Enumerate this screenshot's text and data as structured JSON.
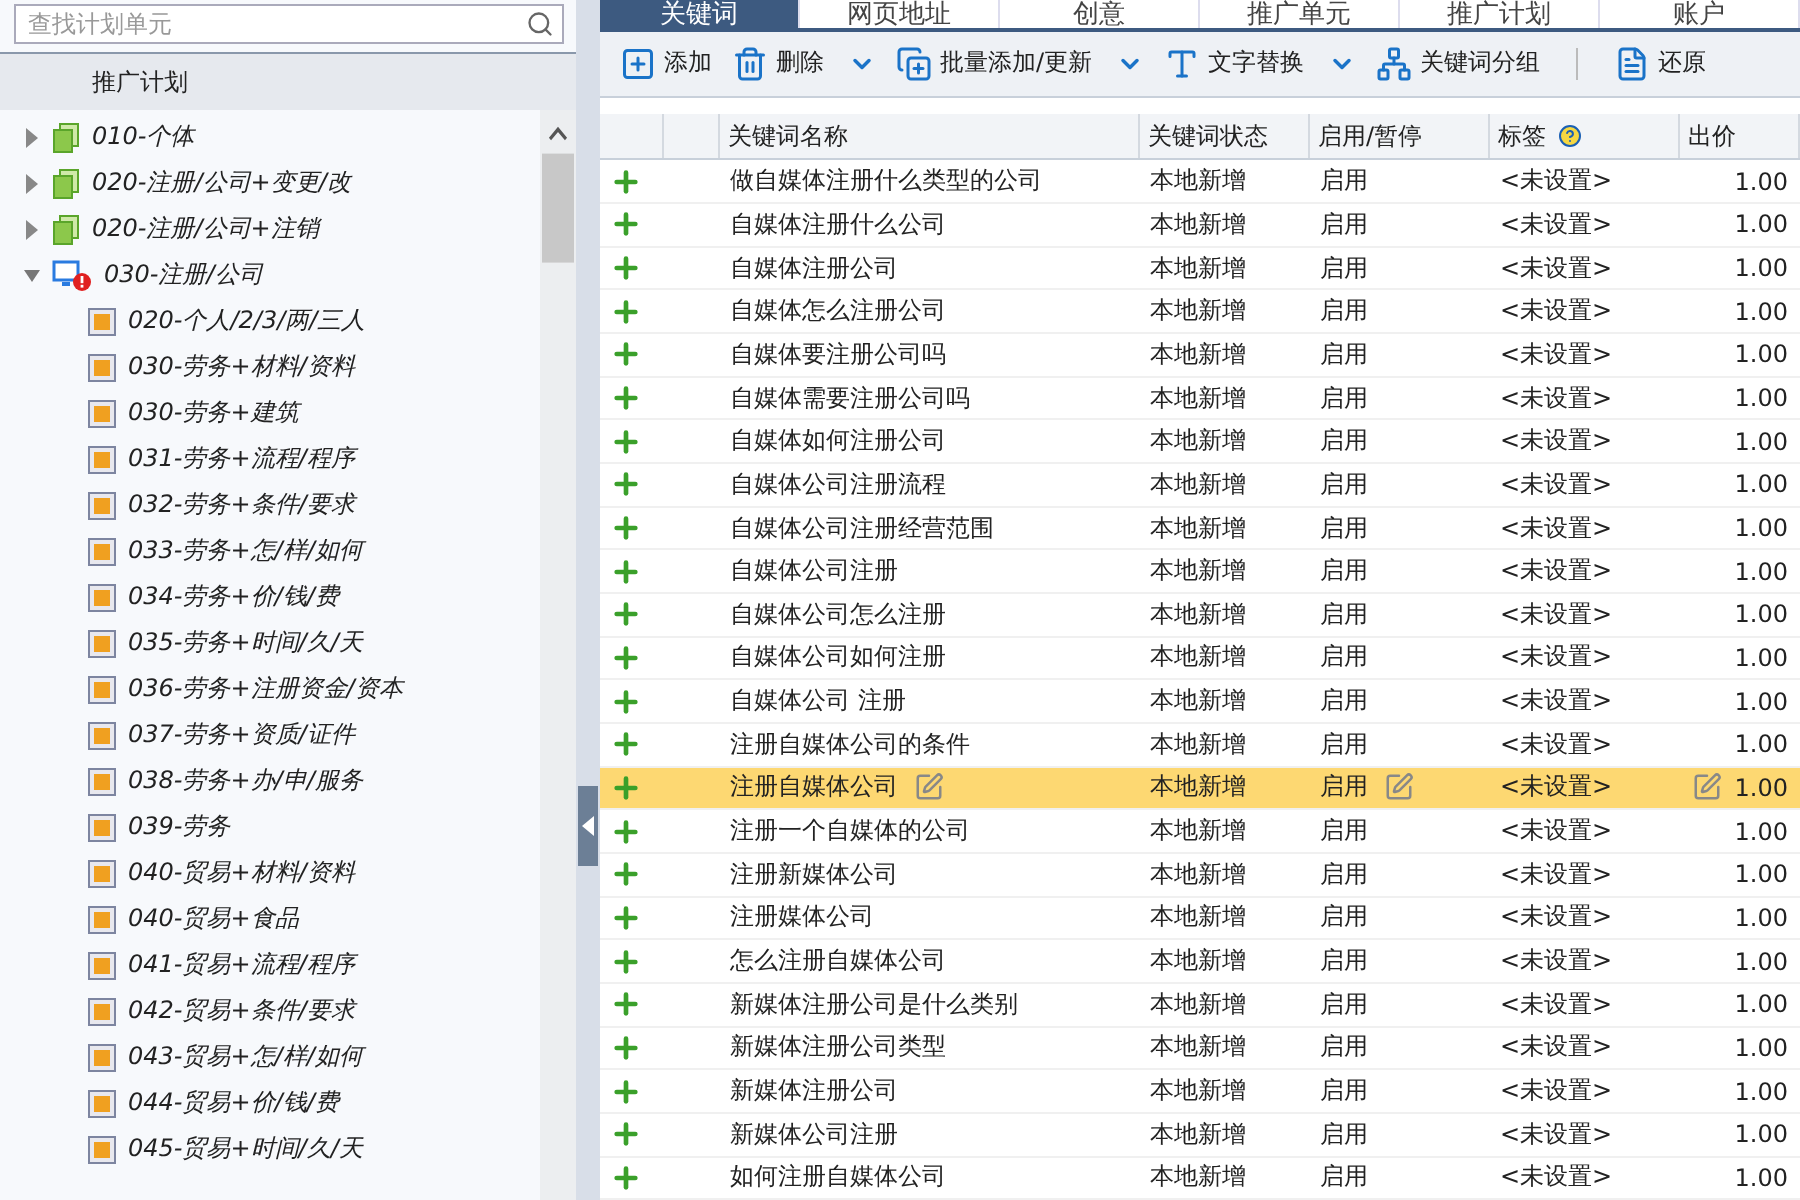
{
  "search": {
    "placeholder": "查找计划单元"
  },
  "sidebar": {
    "header": "推广计划",
    "tree": [
      {
        "label": "010-个体",
        "kind": "plan",
        "expanded": false
      },
      {
        "label": "020-注册/公司+变更/改",
        "kind": "plan",
        "expanded": false
      },
      {
        "label": "020-注册/公司+注销",
        "kind": "plan",
        "expanded": false
      },
      {
        "label": "030-注册/公司",
        "kind": "plan-alert",
        "expanded": true,
        "children": [
          {
            "label": "020-个人/2/3/两/三人",
            "kind": "unit"
          },
          {
            "label": "030-劳务+材料/资料",
            "kind": "unit"
          },
          {
            "label": "030-劳务+建筑",
            "kind": "unit"
          },
          {
            "label": "031-劳务+流程/程序",
            "kind": "unit"
          },
          {
            "label": "032-劳务+条件/要求",
            "kind": "unit"
          },
          {
            "label": "033-劳务+怎/样/如何",
            "kind": "unit"
          },
          {
            "label": "034-劳务+价/钱/费",
            "kind": "unit"
          },
          {
            "label": "035-劳务+时间/久/天",
            "kind": "unit"
          },
          {
            "label": "036-劳务+注册资金/资本",
            "kind": "unit"
          },
          {
            "label": "037-劳务+资质/证件",
            "kind": "unit"
          },
          {
            "label": "038-劳务+办/申/服务",
            "kind": "unit"
          },
          {
            "label": "039-劳务",
            "kind": "unit"
          },
          {
            "label": "040-贸易+材料/资料",
            "kind": "unit"
          },
          {
            "label": "040-贸易+食品",
            "kind": "unit"
          },
          {
            "label": "041-贸易+流程/程序",
            "kind": "unit"
          },
          {
            "label": "042-贸易+条件/要求",
            "kind": "unit"
          },
          {
            "label": "043-贸易+怎/样/如何",
            "kind": "unit"
          },
          {
            "label": "044-贸易+价/钱/费",
            "kind": "unit"
          },
          {
            "label": "045-贸易+时间/久/天",
            "kind": "unit"
          }
        ]
      }
    ]
  },
  "tabs": [
    {
      "label": "关键词",
      "selected": true
    },
    {
      "label": "网页地址",
      "selected": false
    },
    {
      "label": "创意",
      "selected": false
    },
    {
      "label": "推广单元",
      "selected": false
    },
    {
      "label": "推广计划",
      "selected": false
    },
    {
      "label": "账户",
      "selected": false
    }
  ],
  "toolbar": [
    {
      "label": "添加",
      "kind": "add",
      "dropdown": false
    },
    {
      "label": "删除",
      "kind": "delete",
      "dropdown": true
    },
    {
      "label": "批量添加/更新",
      "kind": "batch",
      "dropdown": true
    },
    {
      "label": "文字替换",
      "kind": "replace",
      "dropdown": true
    },
    {
      "label": "关键词分组",
      "kind": "group",
      "dropdown": false
    },
    {
      "label": "还原",
      "kind": "restore",
      "dropdown": false
    }
  ],
  "table": {
    "columns": [
      "关键词名称",
      "关键词状态",
      "启用/暂停",
      "标签",
      "出价"
    ],
    "rows": [
      {
        "name": "做自媒体注册什么类型的公司",
        "status": "本地新增",
        "enabled": "启用",
        "tag": "<未设置>",
        "bid": "1.00",
        "selected": false
      },
      {
        "name": "自媒体注册什么公司",
        "status": "本地新增",
        "enabled": "启用",
        "tag": "<未设置>",
        "bid": "1.00",
        "selected": false
      },
      {
        "name": "自媒体注册公司",
        "status": "本地新增",
        "enabled": "启用",
        "tag": "<未设置>",
        "bid": "1.00",
        "selected": false
      },
      {
        "name": "自媒体怎么注册公司",
        "status": "本地新增",
        "enabled": "启用",
        "tag": "<未设置>",
        "bid": "1.00",
        "selected": false
      },
      {
        "name": "自媒体要注册公司吗",
        "status": "本地新增",
        "enabled": "启用",
        "tag": "<未设置>",
        "bid": "1.00",
        "selected": false
      },
      {
        "name": "自媒体需要注册公司吗",
        "status": "本地新增",
        "enabled": "启用",
        "tag": "<未设置>",
        "bid": "1.00",
        "selected": false
      },
      {
        "name": "自媒体如何注册公司",
        "status": "本地新增",
        "enabled": "启用",
        "tag": "<未设置>",
        "bid": "1.00",
        "selected": false
      },
      {
        "name": "自媒体公司注册流程",
        "status": "本地新增",
        "enabled": "启用",
        "tag": "<未设置>",
        "bid": "1.00",
        "selected": false
      },
      {
        "name": "自媒体公司注册经营范围",
        "status": "本地新增",
        "enabled": "启用",
        "tag": "<未设置>",
        "bid": "1.00",
        "selected": false
      },
      {
        "name": "自媒体公司注册",
        "status": "本地新增",
        "enabled": "启用",
        "tag": "<未设置>",
        "bid": "1.00",
        "selected": false
      },
      {
        "name": "自媒体公司怎么注册",
        "status": "本地新增",
        "enabled": "启用",
        "tag": "<未设置>",
        "bid": "1.00",
        "selected": false
      },
      {
        "name": "自媒体公司如何注册",
        "status": "本地新增",
        "enabled": "启用",
        "tag": "<未设置>",
        "bid": "1.00",
        "selected": false
      },
      {
        "name": "自媒体公司 注册",
        "status": "本地新增",
        "enabled": "启用",
        "tag": "<未设置>",
        "bid": "1.00",
        "selected": false
      },
      {
        "name": "注册自媒体公司的条件",
        "status": "本地新增",
        "enabled": "启用",
        "tag": "<未设置>",
        "bid": "1.00",
        "selected": false
      },
      {
        "name": "注册自媒体公司",
        "status": "本地新增",
        "enabled": "启用",
        "tag": "<未设置>",
        "bid": "1.00",
        "selected": true
      },
      {
        "name": "注册一个自媒体的公司",
        "status": "本地新增",
        "enabled": "启用",
        "tag": "<未设置>",
        "bid": "1.00",
        "selected": false
      },
      {
        "name": "注册新媒体公司",
        "status": "本地新增",
        "enabled": "启用",
        "tag": "<未设置>",
        "bid": "1.00",
        "selected": false
      },
      {
        "name": "注册媒体公司",
        "status": "本地新增",
        "enabled": "启用",
        "tag": "<未设置>",
        "bid": "1.00",
        "selected": false
      },
      {
        "name": "怎么注册自媒体公司",
        "status": "本地新增",
        "enabled": "启用",
        "tag": "<未设置>",
        "bid": "1.00",
        "selected": false
      },
      {
        "name": "新媒体注册公司是什么类别",
        "status": "本地新增",
        "enabled": "启用",
        "tag": "<未设置>",
        "bid": "1.00",
        "selected": false
      },
      {
        "name": "新媒体注册公司类型",
        "status": "本地新增",
        "enabled": "启用",
        "tag": "<未设置>",
        "bid": "1.00",
        "selected": false
      },
      {
        "name": "新媒体注册公司",
        "status": "本地新增",
        "enabled": "启用",
        "tag": "<未设置>",
        "bid": "1.00",
        "selected": false
      },
      {
        "name": "新媒体公司注册",
        "status": "本地新增",
        "enabled": "启用",
        "tag": "<未设置>",
        "bid": "1.00",
        "selected": false
      },
      {
        "name": "如何注册自媒体公司",
        "status": "本地新增",
        "enabled": "启用",
        "tag": "<未设置>",
        "bid": "1.00",
        "selected": false
      }
    ]
  }
}
